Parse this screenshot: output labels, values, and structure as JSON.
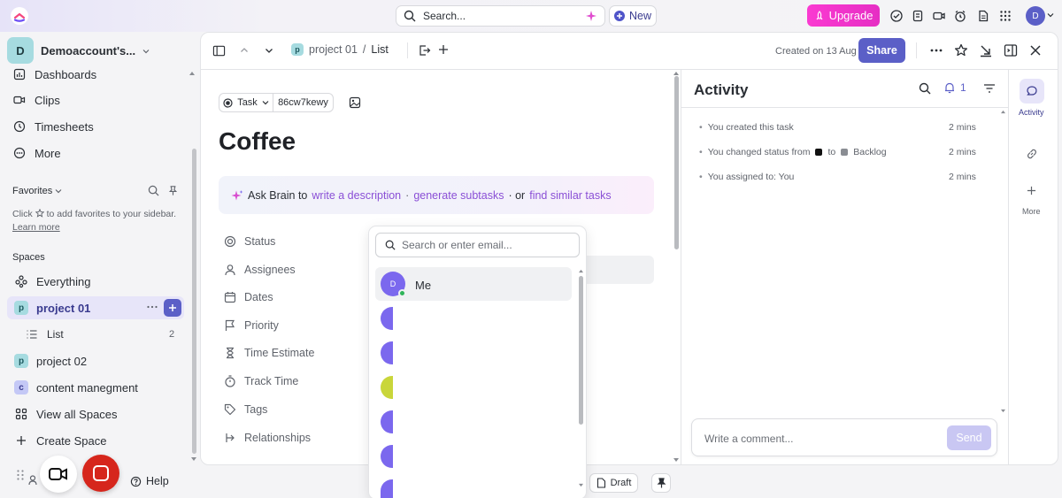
{
  "topbar": {
    "search_placeholder": "Search...",
    "new_label": "New",
    "upgrade_label": "Upgrade",
    "user_initial": "D"
  },
  "sidebar": {
    "workspace_initial": "D",
    "workspace_name": "Demoaccount's...",
    "nav": [
      {
        "label": "Dashboards",
        "icon": "dashboard-icon"
      },
      {
        "label": "Clips",
        "icon": "clips-icon"
      },
      {
        "label": "Timesheets",
        "icon": "clock-icon"
      },
      {
        "label": "More",
        "icon": "more-circle-icon"
      }
    ],
    "favorites_label": "Favorites",
    "favorites_hint_1": "Click",
    "favorites_hint_2": "to add favorites to your sidebar.",
    "favorites_link": "Learn more",
    "spaces_label": "Spaces",
    "everything_label": "Everything",
    "spaces": [
      {
        "badge": "p",
        "name": "project 01",
        "color": "#a6dbe0",
        "active": true
      },
      {
        "badge": "p",
        "name": "project 02",
        "color": "#a6dbe0"
      },
      {
        "badge": "c",
        "name": "content manegment",
        "color": "#c4c8f6"
      }
    ],
    "list_label": "List",
    "list_count": "2",
    "view_all_spaces": "View all Spaces",
    "create_space": "Create Space",
    "help_label": "Help"
  },
  "header": {
    "breadcrumb_badge": "p",
    "breadcrumb_space": "project 01",
    "breadcrumb_sep": "/",
    "breadcrumb_list": "List",
    "created_on": "Created on 13 Aug",
    "share_label": "Share"
  },
  "task": {
    "type_label": "Task",
    "task_id": "86cw7kewy",
    "title": "Coffee",
    "brain_prefix": "Ask Brain to",
    "brain_link_1": "write a description",
    "brain_dot_1": "·",
    "brain_link_2": "generate subtasks",
    "brain_dot_2": "· or",
    "brain_link_3": "find similar tasks",
    "fields": [
      {
        "label": "Status",
        "icon": "status-icon"
      },
      {
        "label": "Assignees",
        "icon": "user-icon"
      },
      {
        "label": "Dates",
        "icon": "calendar-icon"
      },
      {
        "label": "Priority",
        "icon": "flag-icon"
      },
      {
        "label": "Time Estimate",
        "icon": "hourglass-icon"
      },
      {
        "label": "Track Time",
        "icon": "stopwatch-icon"
      },
      {
        "label": "Tags",
        "icon": "tag-icon"
      },
      {
        "label": "Relationships",
        "icon": "relationship-icon"
      }
    ],
    "draft_label": "Draft"
  },
  "assignee_dropdown": {
    "search_placeholder": "Search or enter email...",
    "me_initial": "D",
    "me_label": "Me",
    "other_avatar_colors": [
      "#7b68ee",
      "#7b68ee",
      "#c9d63a",
      "#7b68ee",
      "#7b68ee",
      "#7b68ee"
    ]
  },
  "activity": {
    "title": "Activity",
    "notification_count": "1",
    "items": [
      {
        "text": "You created this task",
        "time": "2 mins"
      },
      {
        "text_prefix": "You changed status from",
        "to_word": "to",
        "status_to": "Backlog",
        "time": "2 mins"
      },
      {
        "text": "You assigned to: You",
        "time": "2 mins"
      }
    ],
    "comment_placeholder": "Write a comment...",
    "send_label": "Send"
  },
  "right_rail": {
    "activity_label": "Activity",
    "more_label": "More"
  },
  "colors": {
    "accent": "#7b68ee",
    "share": "#5b5fc7",
    "upgrade": "#f53ad3",
    "link": "#8a4fd6"
  }
}
